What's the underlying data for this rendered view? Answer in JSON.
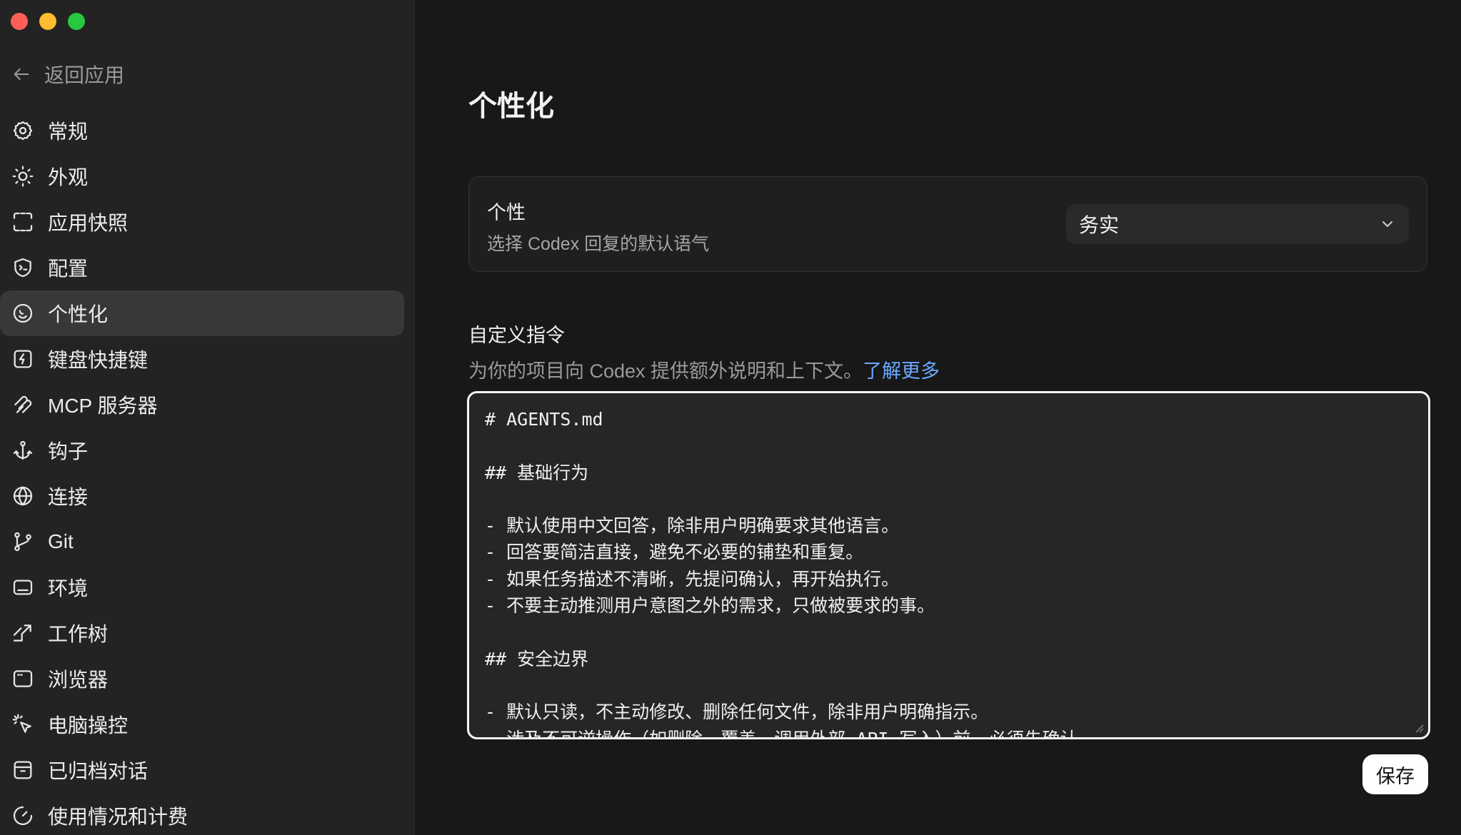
{
  "sidebar": {
    "back_label": "返回应用",
    "items": [
      {
        "label": "常规",
        "icon": "gear-icon"
      },
      {
        "label": "外观",
        "icon": "sun-icon"
      },
      {
        "label": "应用快照",
        "icon": "snapshot-icon"
      },
      {
        "label": "配置",
        "icon": "shield-terminal-icon"
      },
      {
        "label": "个性化",
        "icon": "personalize-icon",
        "active": true
      },
      {
        "label": "键盘快捷键",
        "icon": "lightning-key-icon"
      },
      {
        "label": "MCP 服务器",
        "icon": "mcp-icon"
      },
      {
        "label": "钩子",
        "icon": "anchor-icon"
      },
      {
        "label": "连接",
        "icon": "globe-icon"
      },
      {
        "label": "Git",
        "icon": "git-branch-icon"
      },
      {
        "label": "环境",
        "icon": "monitor-icon"
      },
      {
        "label": "工作树",
        "icon": "worktree-icon"
      },
      {
        "label": "浏览器",
        "icon": "browser-icon"
      },
      {
        "label": "电脑操控",
        "icon": "cursor-click-icon"
      },
      {
        "label": "已归档对话",
        "icon": "archive-icon"
      },
      {
        "label": "使用情况和计费",
        "icon": "gauge-icon"
      }
    ]
  },
  "main": {
    "title": "个性化",
    "personality": {
      "title": "个性",
      "subtitle": "选择 Codex 回复的默认语气",
      "selected": "务实"
    },
    "custom": {
      "title": "自定义指令",
      "subtitle": "为你的项目向 Codex 提供额外说明和上下文。",
      "link": "了解更多",
      "content": "# AGENTS.md\n\n## 基础行为\n\n- 默认使用中文回答，除非用户明确要求其他语言。\n- 回答要简洁直接，避免不必要的铺垫和重复。\n- 如果任务描述不清晰，先提问确认，再开始执行。\n- 不要主动推测用户意图之外的需求，只做被要求的事。\n\n## 安全边界\n\n- 默认只读，不主动修改、删除任何文件，除非用户明确指示。\n- 涉及不可逆操作（如删除、覆盖、调用外部 API 写入）前，必须先确认。"
    },
    "save_label": "保存"
  },
  "colors": {
    "link": "#6aa9ff",
    "close": "#ff5f57",
    "minimize": "#febc2e",
    "maximize": "#28c840"
  }
}
